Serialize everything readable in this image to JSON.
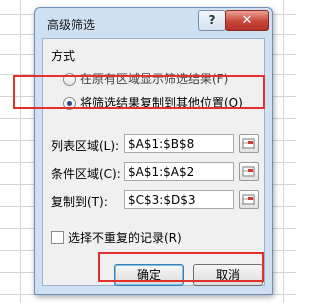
{
  "dialog": {
    "title": "高级筛选",
    "help_glyph": "?",
    "close_glyph": "✕"
  },
  "method": {
    "heading": "方式",
    "option_in_place": "在原有区域显示筛选结果(F)",
    "option_copy": "将筛选结果复制到其他位置(O)",
    "selected": "option_copy"
  },
  "fields": {
    "list_range_label": "列表区域(L):",
    "list_range_value": "$A$1:$B$8",
    "criteria_range_label": "条件区域(C):",
    "criteria_range_value": "$A$1:$A$2",
    "copy_to_label": "复制到(T):",
    "copy_to_value": "$C$3:$D$3"
  },
  "unique_records": {
    "label": "选择不重复的记录(R)",
    "checked": false
  },
  "buttons": {
    "ok": "确定",
    "cancel": "取消"
  },
  "colors": {
    "highlight_box": "#e0312b",
    "highlight_buttons": "#e0312b",
    "title_bar": "#cfe0f3",
    "close_button": "#c9453a"
  }
}
